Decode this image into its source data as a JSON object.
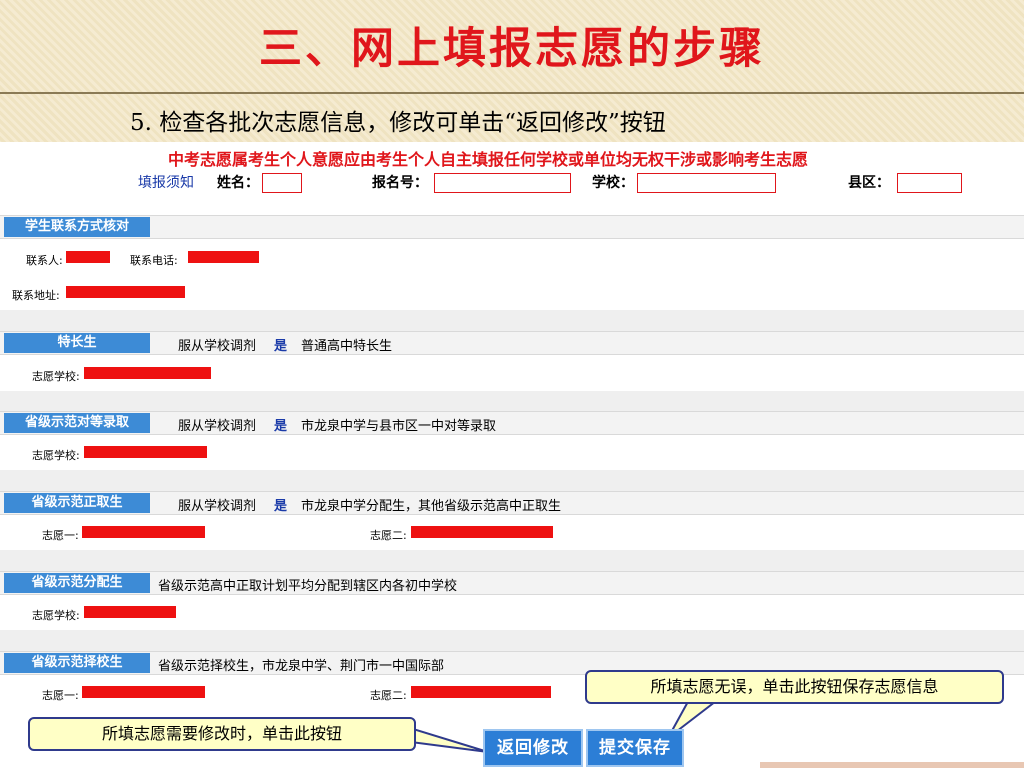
{
  "slide": {
    "title": "三、网上填报志愿的步骤",
    "step": "5. 检查各批次志愿信息，修改可单击“返回修改”按钮"
  },
  "form": {
    "notice": "中考志愿属考生个人意愿应由考生个人自主填报任何学校或单位均无权干涉或影响考生志愿",
    "guide_link": "填报须知",
    "name_label": "姓名：",
    "reg_label": "报名号：",
    "school_label": "学校：",
    "county_label": "县区："
  },
  "contact": {
    "header": "学生联系方式核对",
    "contact_person_label": "联系人:",
    "phone_label": "联系电话:",
    "address_label": "联系地址:"
  },
  "sections": [
    {
      "label": "特长生",
      "obey": "服从学校调剂",
      "yes": "是",
      "desc": "普通高中特长生",
      "field1": "志愿学校:"
    },
    {
      "label": "省级示范对等录取",
      "obey": "服从学校调剂",
      "yes": "是",
      "desc": "市龙泉中学与县市区一中对等录取",
      "field1": "志愿学校:"
    },
    {
      "label": "省级示范正取生",
      "obey": "服从学校调剂",
      "yes": "是",
      "desc": "市龙泉中学分配生，其他省级示范高中正取生",
      "field1": "志愿一:",
      "field2": "志愿二:"
    },
    {
      "label": "省级示范分配生",
      "desc": "省级示范高中正取计划平均分配到辖区内各初中学校",
      "field1": "志愿学校:"
    },
    {
      "label": "省级示范择校生",
      "desc": "省级示范择校生，市龙泉中学、荆门市一中国际部",
      "field1": "志愿一:",
      "field2": "志愿二:"
    }
  ],
  "callouts": {
    "save_tip": "所填志愿无误，单击此按钮保存志愿信息",
    "back_tip": "所填志愿需要修改时，单击此按钮"
  },
  "buttons": {
    "back": "返回修改",
    "submit": "提交保存"
  }
}
